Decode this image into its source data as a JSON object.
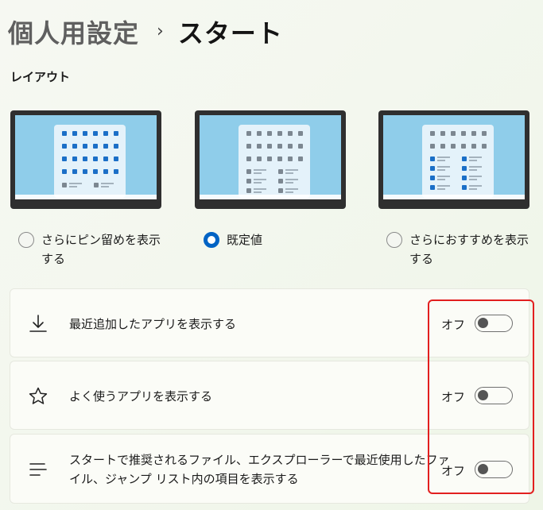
{
  "breadcrumb": {
    "parent": "個人用設定",
    "separator": "›",
    "current": "スタート"
  },
  "layout": {
    "label": "レイアウト",
    "options": [
      {
        "label": "さらにピン留めを表示\nする",
        "selected": false
      },
      {
        "label": "既定値",
        "selected": true
      },
      {
        "label": "さらにおすすめを表示\nする",
        "selected": false
      }
    ]
  },
  "settings": [
    {
      "icon": "download-icon",
      "label": "最近追加したアプリを表示する",
      "state": "オフ",
      "on": false
    },
    {
      "icon": "star-icon",
      "label": "よく使うアプリを表示する",
      "state": "オフ",
      "on": false
    },
    {
      "icon": "list-icon",
      "label": "スタートで推奨されるファイル、エクスプローラーで最近使用したファ\nイル、ジャンプ リスト内の項目を表示する",
      "state": "オフ",
      "on": false
    }
  ],
  "colors": {
    "accent": "#0063c4",
    "highlight": "#e21f1f"
  }
}
